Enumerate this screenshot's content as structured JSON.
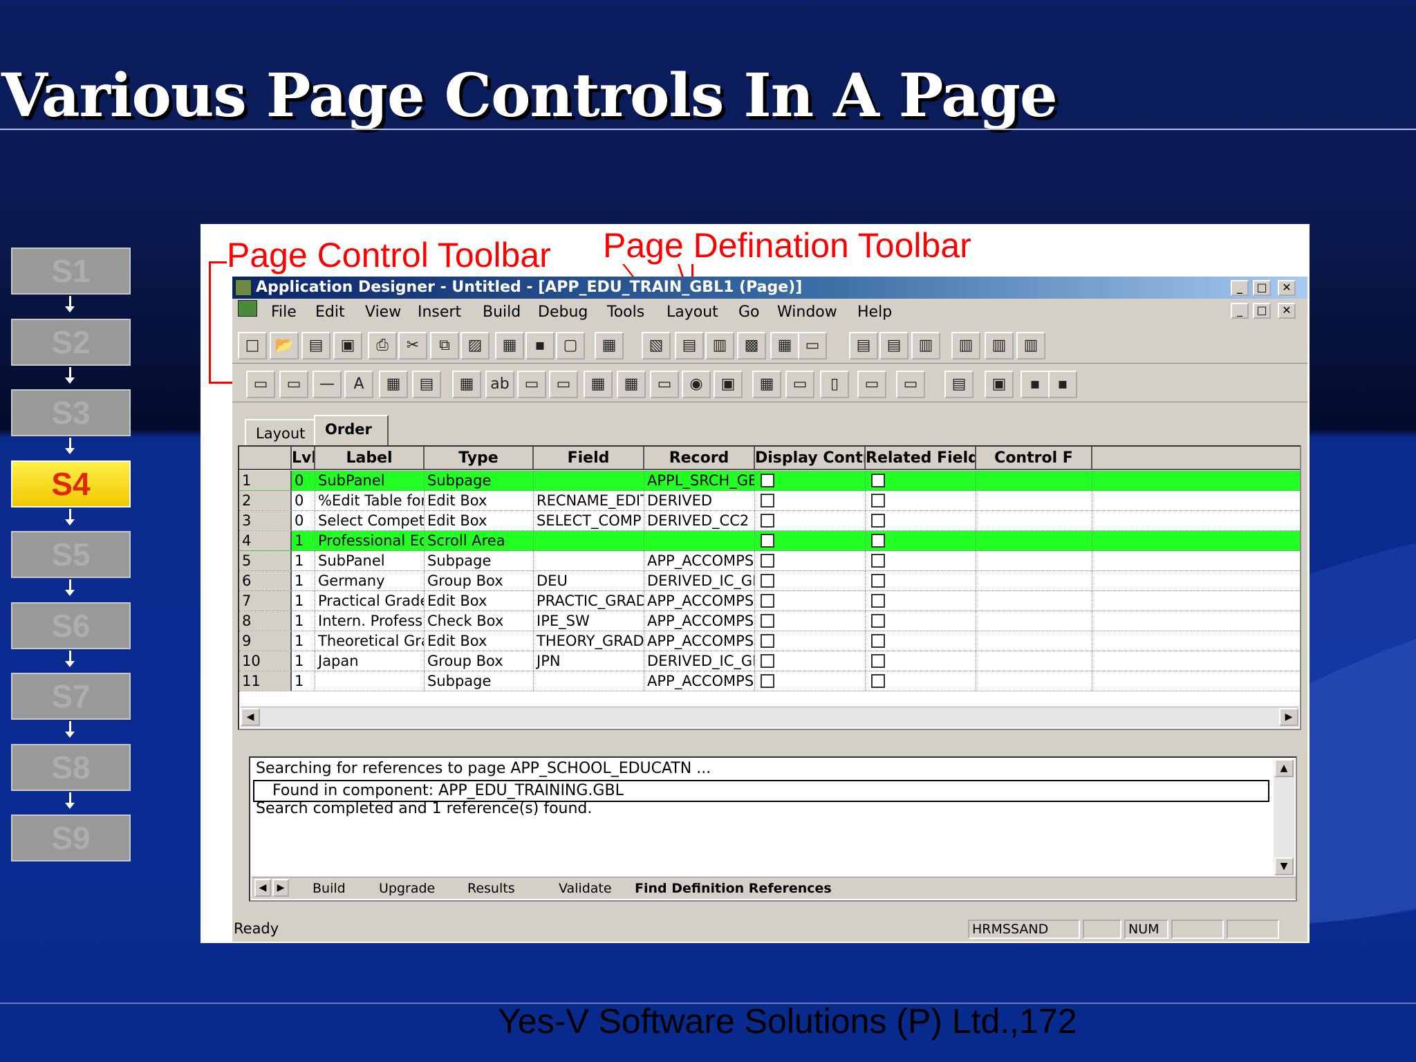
{
  "slide": {
    "title": "Various Page Controls In A Page",
    "footer": "Yes-V Software Solutions (P) Ltd.,172"
  },
  "steps": {
    "items": [
      "S1",
      "S2",
      "S3",
      "S4",
      "S5",
      "S6",
      "S7",
      "S8",
      "S9"
    ],
    "active": "S4"
  },
  "annotations": {
    "page_control": "Page Control Toolbar",
    "page_definition": "Page Defination Toolbar",
    "color": "#ff0000"
  },
  "window": {
    "title": "Application Designer - Untitled - [APP_EDU_TRAIN_GBL1 (Page)]",
    "controls": [
      "_",
      "□",
      "✕"
    ],
    "menu": [
      "File",
      "Edit",
      "View",
      "Insert",
      "Build",
      "Debug",
      "Tools",
      "Layout",
      "Go",
      "Window",
      "Help"
    ],
    "tabs": [
      "Layout",
      "Order"
    ],
    "active_tab": "Order",
    "columns": [
      "Lvl",
      "Label",
      "Type",
      "Field",
      "Record",
      "Display Control",
      "Related Field",
      "Control F"
    ],
    "rows": [
      {
        "n": "1",
        "lvl": "0",
        "label": "SubPanel",
        "type": "Subpage",
        "field": "",
        "record": "APPL_SRCH_GB",
        "hl": true
      },
      {
        "n": "2",
        "lvl": "0",
        "label": "%Edit Table for R",
        "type": "Edit Box",
        "field": "RECNAME_EDIT",
        "record": "DERIVED",
        "hl": false
      },
      {
        "n": "3",
        "lvl": "0",
        "label": "Select Competenc",
        "type": "Edit Box",
        "field": "SELECT_COMP",
        "record": "DERIVED_CC2",
        "hl": false
      },
      {
        "n": "4",
        "lvl": "1",
        "label": "Professional Educ",
        "type": "Scroll Area",
        "field": "",
        "record": "",
        "hl": true
      },
      {
        "n": "5",
        "lvl": "1",
        "label": "SubPanel",
        "type": "Subpage",
        "field": "",
        "record": "APP_ACCOMPS",
        "hl": false
      },
      {
        "n": "6",
        "lvl": "1",
        "label": "Germany",
        "type": "Group Box",
        "field": "DEU",
        "record": "DERIVED_IC_GB",
        "hl": false
      },
      {
        "n": "7",
        "lvl": "1",
        "label": "Practical Grade",
        "type": "Edit Box",
        "field": "PRACTIC_GRAD",
        "record": "APP_ACCOMPS",
        "hl": false
      },
      {
        "n": "8",
        "lvl": "1",
        "label": "Intern. Profession",
        "type": "Check Box",
        "field": "IPE_SW",
        "record": "APP_ACCOMPS",
        "hl": false
      },
      {
        "n": "9",
        "lvl": "1",
        "label": "Theoretical Grade",
        "type": "Edit Box",
        "field": "THEORY_GRAD",
        "record": "APP_ACCOMPS",
        "hl": false
      },
      {
        "n": "10",
        "lvl": "1",
        "label": "Japan",
        "type": "Group Box",
        "field": "JPN",
        "record": "DERIVED_IC_GB",
        "hl": false
      },
      {
        "n": "11",
        "lvl": "1",
        "label": "",
        "type": "Subpage",
        "field": "",
        "record": "APP_ACCOMPS",
        "hl": false
      }
    ],
    "highlight_color": "#22ff22",
    "output": [
      "Searching for references to page APP_SCHOOL_EDUCATN ...",
      "Found in component: APP_EDU_TRAINING.GBL",
      "Search completed and 1 reference(s) found."
    ],
    "output_tabs": [
      "Build",
      "Upgrade",
      "Results",
      "Validate",
      "Find Definition References"
    ],
    "status": {
      "text": "Ready",
      "server": "HRMSSAND",
      "num": "NUM"
    }
  }
}
